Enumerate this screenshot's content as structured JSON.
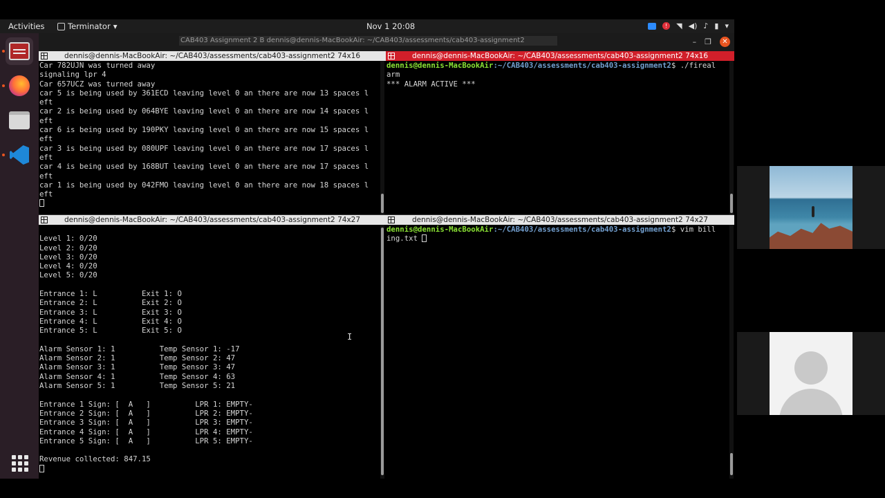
{
  "topbar": {
    "activities": "Activities",
    "app_name": "Terminator",
    "clock": "Nov 1  20:08"
  },
  "window": {
    "title_strip": "CAB403 Assignment 2 B  dennis@dennis-MacBookAir: ~/CAB403/assessments/cab403-assignment2"
  },
  "panes": {
    "top_left": {
      "title": "dennis@dennis-MacBookAir: ~/CAB403/assessments/cab403-assignment2 74x16",
      "lines": [
        "Car 782UJN was turned away",
        "signaling lpr 4",
        "Car 657UCZ was turned away",
        "car 5 is being used by 361ECD leaving level 0 an there are now 13 spaces l",
        "eft",
        "car 2 is being used by 064BYE leaving level 0 an there are now 14 spaces l",
        "eft",
        "car 6 is being used by 190PKY leaving level 0 an there are now 15 spaces l",
        "eft",
        "car 3 is being used by 080UPF leaving level 0 an there are now 17 spaces l",
        "eft",
        "car 4 is being used by 168BUT leaving level 0 an there are now 17 spaces l",
        "eft",
        "car 1 is being used by 042FMO leaving level 0 an there are now 18 spaces l",
        "eft"
      ]
    },
    "top_right": {
      "title": "dennis@dennis-MacBookAir: ~/CAB403/assessments/cab403-assignment2 74x16",
      "prompt_user": "dennis@dennis-MacBookAir",
      "prompt_path": ":~/CAB403/assessments/cab403-assignment2",
      "command": "$ ./fireal",
      "command_wrap": "arm",
      "output": "*** ALARM ACTIVE ***"
    },
    "bottom_left": {
      "title": "dennis@dennis-MacBookAir: ~/CAB403/assessments/cab403-assignment2 74x27",
      "lines": [
        "",
        "Level 1: 0/20",
        "Level 2: 0/20",
        "Level 3: 0/20",
        "Level 4: 0/20",
        "Level 5: 0/20",
        "",
        "Entrance 1: L          Exit 1: O",
        "Entrance 2: L          Exit 2: O",
        "Entrance 3: L          Exit 3: O",
        "Entrance 4: L          Exit 4: O",
        "Entrance 5: L          Exit 5: O",
        "",
        "Alarm Sensor 1: 1          Temp Sensor 1: -17",
        "Alarm Sensor 2: 1          Temp Sensor 2: 47",
        "Alarm Sensor 3: 1          Temp Sensor 3: 47",
        "Alarm Sensor 4: 1          Temp Sensor 4: 63",
        "Alarm Sensor 5: 1          Temp Sensor 5: 21",
        "",
        "Entrance 1 Sign: [  A   ]          LPR 1: EMPTY-",
        "Entrance 2 Sign: [  A   ]          LPR 2: EMPTY-",
        "Entrance 3 Sign: [  A   ]          LPR 3: EMPTY-",
        "Entrance 4 Sign: [  A   ]          LPR 4: EMPTY-",
        "Entrance 5 Sign: [  A   ]          LPR 5: EMPTY-",
        "",
        "Revenue collected: 847.15"
      ]
    },
    "bottom_right": {
      "title": "dennis@dennis-MacBookAir: ~/CAB403/assessments/cab403-assignment2 74x27",
      "prompt_user": "dennis@dennis-MacBookAir",
      "prompt_path": ":~/CAB403/assessments/cab403-assignment2",
      "command": "$ vim bill",
      "command_wrap": "ing.txt "
    }
  },
  "colors": {
    "active_title": "#d11f2a",
    "inactive_title": "#e6e6e6",
    "accent": "#e95420"
  },
  "icons": [
    "terminator-icon",
    "firefox-icon",
    "files-icon",
    "vscode-icon",
    "show-apps-icon",
    "zoom-icon",
    "record-icon",
    "wifi-icon",
    "volume-icon",
    "mic-icon",
    "battery-icon",
    "power-menu-icon"
  ]
}
